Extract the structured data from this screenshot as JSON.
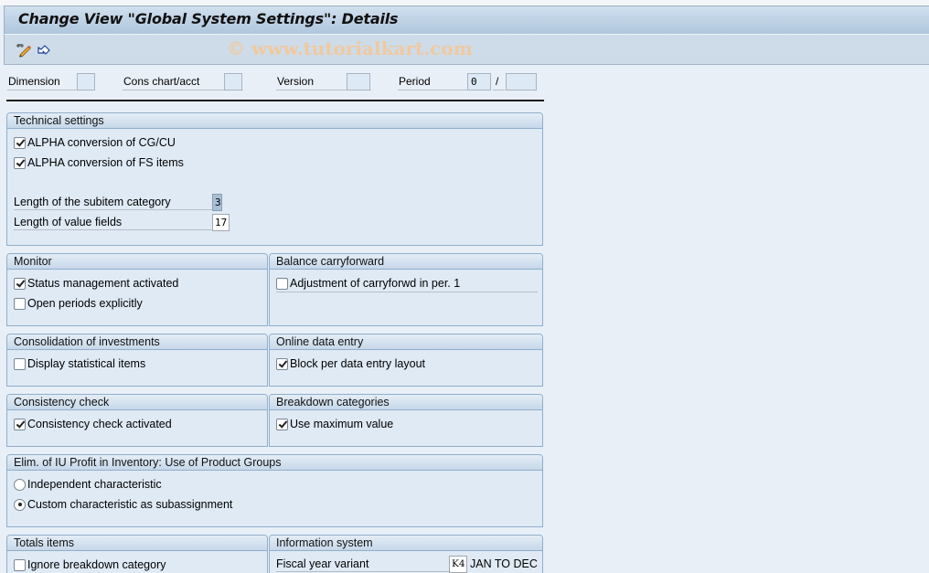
{
  "window": {
    "title": "Change View \"Global System Settings\": Details"
  },
  "toolbar": {
    "watermark": "© www.tutorialkart.com",
    "icons": [
      {
        "name": "display-change-icon",
        "tooltip": ""
      },
      {
        "name": "undo-icon",
        "tooltip": ""
      }
    ]
  },
  "header_fields": {
    "dimension": {
      "label": "Dimension",
      "value": ""
    },
    "cons_chart": {
      "label": "Cons chart/acct",
      "value": ""
    },
    "version": {
      "label": "Version",
      "value": ""
    },
    "period": {
      "label": "Period",
      "value": "0",
      "separator": "/",
      "year_value": ""
    }
  },
  "technical_settings": {
    "title": "Technical settings",
    "alpha_cg_cu": {
      "label": "ALPHA conversion of CG/CU",
      "checked": true
    },
    "alpha_fs_items": {
      "label": "ALPHA conversion of FS items",
      "checked": true
    },
    "subitem_length": {
      "label": "Length of the subitem category",
      "value": "3"
    },
    "value_length": {
      "label": "Length of value fields",
      "value": "17"
    }
  },
  "monitor": {
    "title": "Monitor",
    "status_mgmt": {
      "label": "Status management activated",
      "checked": true
    },
    "open_periods": {
      "label": "Open periods explicitly",
      "checked": false
    }
  },
  "balance_carryforward": {
    "title": "Balance carryforward",
    "adjustment": {
      "label": "Adjustment of carryforwd in per. 1",
      "checked": false
    }
  },
  "consolidation_investments": {
    "title": "Consolidation of investments",
    "display_statistical": {
      "label": "Display statistical items",
      "checked": false
    }
  },
  "online_data_entry": {
    "title": "Online data entry",
    "block_layout": {
      "label": "Block per data entry layout",
      "checked": true
    }
  },
  "consistency_check": {
    "title": "Consistency check",
    "activated": {
      "label": "Consistency check activated",
      "checked": true
    }
  },
  "breakdown_categories": {
    "title": "Breakdown categories",
    "max_value": {
      "label": "Use maximum value",
      "checked": true
    }
  },
  "elim_iu_profit": {
    "title": "Elim. of IU Profit in Inventory: Use of Product Groups",
    "options": [
      {
        "label": "Independent characteristic",
        "selected": false
      },
      {
        "label": "Custom characteristic as subassignment",
        "selected": true
      }
    ]
  },
  "totals_items": {
    "title": "Totals items",
    "ignore_breakdown": {
      "label": "Ignore breakdown category",
      "checked": false
    }
  },
  "information_system": {
    "title": "Information system",
    "fiscal_year_variant": {
      "label": "Fiscal year variant",
      "value": "K4",
      "description": "JAN TO DEC"
    }
  }
}
